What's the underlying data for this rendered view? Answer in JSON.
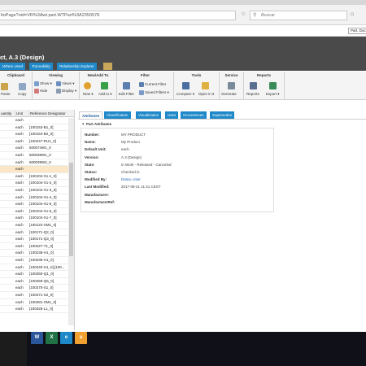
{
  "browser": {
    "url": "ltoPage?oid=VR%3Awt.part.WTPart%3A2350578",
    "search_placeholder": "Buscar",
    "search_icon": "magnifier-icon",
    "context_select": "Part, Docu"
  },
  "header": {
    "title": "ct, A.3 (Design)",
    "subnav": [
      "Where Used",
      "Traceability",
      "Relationship Explorer"
    ]
  },
  "ribbon": {
    "groups": {
      "clipboard": "Clipboard",
      "viewing": "Viewing",
      "new_add": "New/Add To",
      "filter": "Filter",
      "tools": "Tools",
      "service": "Service",
      "reports": "Reports"
    },
    "buttons": {
      "paste": "Paste",
      "copy": "Copy",
      "show": "Show",
      "hide": "Hide",
      "views": "Views",
      "display": "Display",
      "new": "New",
      "add_to": "Add to",
      "current_filter": "Current Filter",
      "edit_filter": "Edit Filter",
      "saved_filters": "Saved Filters",
      "compare": "Compare",
      "open_in": "Open in",
      "generate": "Generate",
      "reports": "Reports",
      "export": "Export"
    }
  },
  "structure": {
    "columns": [
      "uantity",
      "Unit",
      "Reference Designator"
    ],
    "rows": [
      {
        "unit": "each",
        "ref": ""
      },
      {
        "unit": "each",
        "ref": "[100153-B1_0]"
      },
      {
        "unit": "each",
        "ref": "[100154-B2_0]"
      },
      {
        "unit": "each",
        "ref": "[100247-RU1_0]"
      },
      {
        "unit": "each",
        "ref": "500074W1_0"
      },
      {
        "unit": "each",
        "ref": "500038W1_0"
      },
      {
        "unit": "each",
        "ref": "500039W2_0"
      },
      {
        "unit": "each",
        "ref": ""
      },
      {
        "unit": "each",
        "ref": "[100104-X1-1_0]"
      },
      {
        "unit": "each",
        "ref": "[100104-X1-2_0]"
      },
      {
        "unit": "each",
        "ref": "[100104-X1-3_0]"
      },
      {
        "unit": "each",
        "ref": "[100104-X1-4_0]"
      },
      {
        "unit": "each",
        "ref": "[100104-X1-5_0]"
      },
      {
        "unit": "each",
        "ref": "[100104-X1-6_0]"
      },
      {
        "unit": "each",
        "ref": "[100104-X1-7_0]"
      },
      {
        "unit": "each",
        "ref": "[100122-XM1_0]"
      },
      {
        "unit": "each",
        "ref": "[100171-Q2_0]"
      },
      {
        "unit": "each",
        "ref": "[100171-Q3_0]"
      },
      {
        "unit": "each",
        "ref": "[100227-T1_0]"
      },
      {
        "unit": "each",
        "ref": "[100238-H1_0]"
      },
      {
        "unit": "each",
        "ref": "[100239-H1_0]"
      },
      {
        "unit": "each",
        "ref": "[100240-H1_0],[100..."
      },
      {
        "unit": "each",
        "ref": "[100250-Q1_0]"
      },
      {
        "unit": "each",
        "ref": "[100259-Q6_0]"
      },
      {
        "unit": "each",
        "ref": "[100270-S1_0]"
      },
      {
        "unit": "each",
        "ref": "[100271-S2_0]"
      },
      {
        "unit": "each",
        "ref": "[100281-XM1_0]"
      },
      {
        "unit": "each",
        "ref": "[100325-L1_0]"
      }
    ]
  },
  "tabs": [
    "Attributes",
    "Classification",
    "Visualization",
    "Uses",
    "Occurrences",
    "Supersedes"
  ],
  "attributes": {
    "section_title": "Part Attributes",
    "fields": [
      {
        "label": "Number:",
        "value": "MY PRODUCT"
      },
      {
        "label": "Name:",
        "value": "My Product"
      },
      {
        "label": "Default Unit:",
        "value": "each"
      },
      {
        "label": "Version:",
        "value": "A.3 (Design)"
      },
      {
        "label": "State:",
        "value": "In Work - Released - Canceled"
      },
      {
        "label": "Status:",
        "value": "Checked in"
      },
      {
        "label": "Modified By:",
        "value": "Dania, User"
      },
      {
        "label": "Last Modified:",
        "value": "2017-08-21 11:41 CEST"
      },
      {
        "label": "Manufacturer:",
        "value": ""
      },
      {
        "label": "ManufacturerRef:",
        "value": ""
      }
    ]
  },
  "taskbar": {
    "apps": [
      {
        "name": "word-icon",
        "label": "W",
        "color": "#2b579a"
      },
      {
        "name": "excel-icon",
        "label": "X",
        "color": "#217346"
      },
      {
        "name": "ie-icon",
        "label": "e",
        "color": "#1e88c8"
      },
      {
        "name": "amazon-icon",
        "label": "a",
        "color": "#f0a030"
      }
    ]
  },
  "colors": {
    "accent": "#1e88c8",
    "header_dark": "#4a4a4a",
    "selection": "#fbe7c8"
  }
}
